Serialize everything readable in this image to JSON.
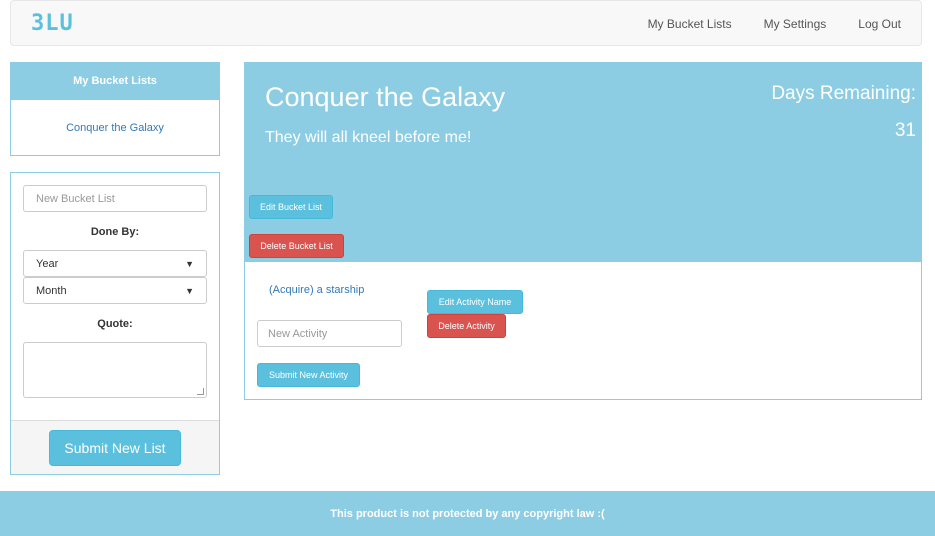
{
  "nav": {
    "brand": "3LU",
    "links": [
      "My Bucket Lists",
      "My Settings",
      "Log Out"
    ]
  },
  "sidebar": {
    "header": "My Bucket Lists",
    "items": [
      "Conquer the Galaxy"
    ]
  },
  "new_list_form": {
    "name_placeholder": "New Bucket List",
    "done_by_label": "Done By:",
    "year_select": "Year",
    "month_select": "Month",
    "quote_label": "Quote:",
    "submit_label": "Submit New List"
  },
  "bucket_list": {
    "title": "Conquer the Galaxy",
    "quote": "They will all kneel before me!",
    "days_remaining_label": "Days Remaining:",
    "days_remaining_value": "31",
    "edit_button": "Edit Bucket List",
    "delete_button": "Delete Bucket List"
  },
  "activities": {
    "items": [
      "(Acquire) a starship"
    ],
    "edit_button": "Edit Activity Name",
    "delete_button": "Delete Activity",
    "new_placeholder": "New Activity",
    "submit_button": "Submit New Activity"
  },
  "footer": {
    "text": "This product is not protected by any copyright law :("
  },
  "colors": {
    "accent": "#8ccde4",
    "info": "#5bc0de",
    "danger": "#d9534f",
    "link": "#337ab7"
  }
}
